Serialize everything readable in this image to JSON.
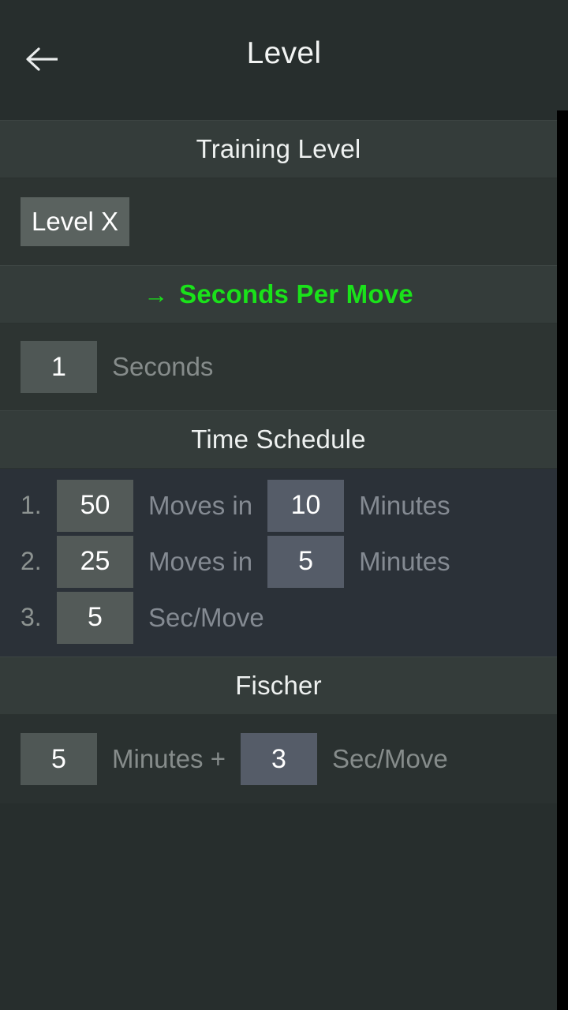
{
  "appbar": {
    "back_icon": "arrow-left-icon",
    "title": "Level"
  },
  "colors": {
    "accent_green": "#1ae21a",
    "page_bg": "#272e2d",
    "section_header_bg": "#343c3a",
    "chip_bg": "#5a625f",
    "label_grey": "#868c8b"
  },
  "sections": {
    "training_level": {
      "header": "Training Level",
      "level_button": "Level X"
    },
    "seconds_per_move": {
      "header": "Seconds Per Move",
      "header_arrow": "→",
      "selected": true,
      "value": "1",
      "unit": "Seconds"
    },
    "time_schedule": {
      "header": "Time Schedule",
      "rows": [
        {
          "index": "1.",
          "moves": "50",
          "moves_label": "Moves in",
          "time": "10",
          "time_label": "Minutes"
        },
        {
          "index": "2.",
          "moves": "25",
          "moves_label": "Moves in",
          "time": "5",
          "time_label": "Minutes"
        },
        {
          "index": "3.",
          "moves": "5",
          "moves_label": "Sec/Move",
          "time": "",
          "time_label": ""
        }
      ]
    },
    "fischer": {
      "header": "Fischer",
      "minutes": "5",
      "minutes_label": "Minutes +",
      "increment": "3",
      "increment_label": "Sec/Move"
    }
  }
}
